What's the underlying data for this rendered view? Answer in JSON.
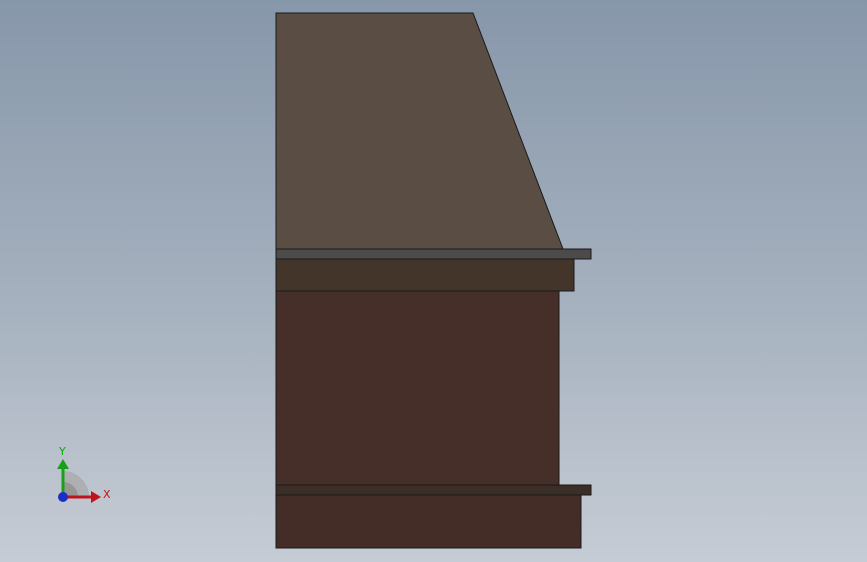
{
  "viewport": {
    "background_top": "#8797aa",
    "background_bottom": "#c6ccd5"
  },
  "model": {
    "hopper_color": "#5a4d43",
    "flange_color": "#4c4b49",
    "collar_color": "#433529",
    "body_color": "#462e29",
    "base_flange_color": "#3b2e27",
    "base_color": "#452d27",
    "edge_color": "#1a1a1a"
  },
  "triad": {
    "x_label": "X",
    "y_label": "Y",
    "x_color": "#c0141c",
    "y_color": "#18a018",
    "z_color": "#1a2fc8"
  }
}
